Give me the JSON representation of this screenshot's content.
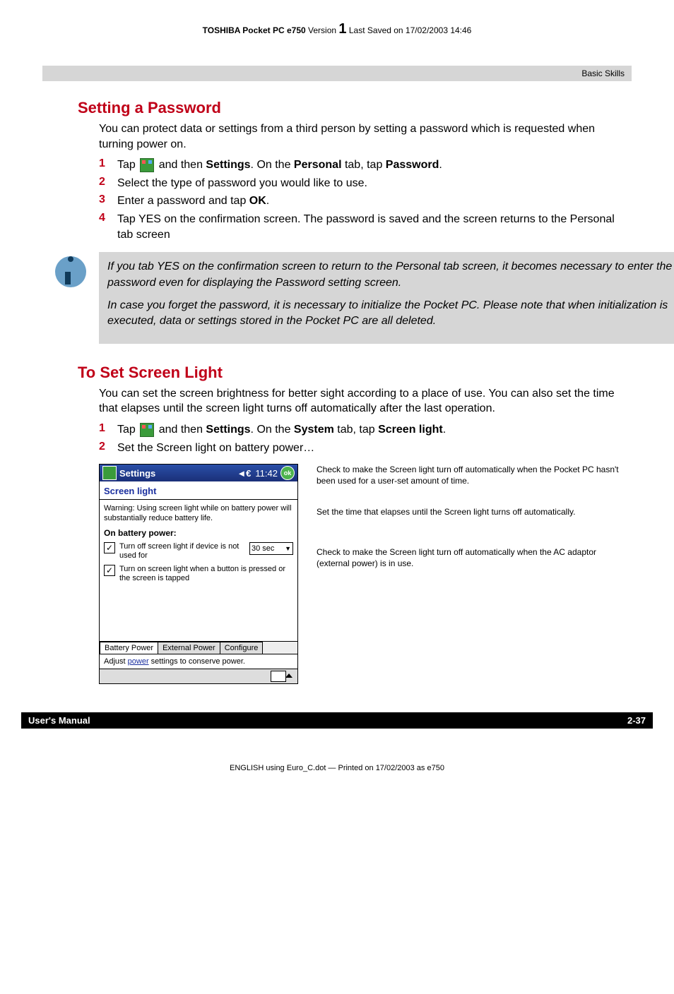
{
  "header": {
    "product_bold": "TOSHIBA Pocket PC e750",
    "version_label": "Version",
    "version_number": "1",
    "saved": "Last Saved on 17/02/2003 14:46"
  },
  "breadcrumb": "Basic Skills",
  "section1": {
    "heading": "Setting a Password",
    "intro": "You can protect data or settings from a third person by setting a password which is requested when turning power on.",
    "steps": {
      "s1a": "Tap ",
      "s1b": " and then ",
      "s1_settings": "Settings",
      "s1c": ". On the ",
      "s1_personal": "Personal",
      "s1d": " tab, tap ",
      "s1_password": "Password",
      "s1e": ".",
      "s2": "Select the type of password you would like to use.",
      "s3a": "Enter a password and tap ",
      "s3_ok": "OK",
      "s3b": ".",
      "s4": "Tap YES on the confirmation screen. The password is saved and the screen returns to the Personal tab screen"
    },
    "note": {
      "p1": "If you tab YES on the confirmation screen to return to the Personal tab screen, it becomes necessary to enter the password even for displaying the Password setting screen.",
      "p2": "In case you forget the password, it is necessary to initialize the Pocket PC. Please note that when initialization is executed, data or settings stored in the Pocket PC are all deleted."
    }
  },
  "section2": {
    "heading": "To Set Screen Light",
    "intro": "You can set the screen brightness for better sight according to a place of use. You can also set the time that elapses until the screen light turns off automatically after the last operation.",
    "steps": {
      "s1a": "Tap ",
      "s1b": " and then ",
      "s1_settings": "Settings",
      "s1c": ". On the ",
      "s1_system": "System",
      "s1d": " tab, tap ",
      "s1_screenlight": "Screen light",
      "s1e": ".",
      "s2": "Set the Screen light on battery power…"
    }
  },
  "screenshot": {
    "titlebar": {
      "title": "Settings",
      "sound": "◄€",
      "time": "11:42",
      "ok": "ok"
    },
    "heading": "Screen light",
    "warning": "Warning: Using screen light while on battery power will substantially reduce battery life.",
    "section": "On battery power:",
    "check1": "Turn off screen light if device is not used for",
    "dropdown": "30 sec",
    "check2": "Turn on screen light when a button is pressed or the screen is tapped",
    "tabs": {
      "t1": "Battery Power",
      "t2": "External Power",
      "t3": "Configure"
    },
    "link_row_a": "Adjust ",
    "link_row_link": "power",
    "link_row_b": " settings to conserve power."
  },
  "callouts": {
    "c1": "Check to make the Screen light turn off automatically when the Pocket PC hasn't been used for a user-set amount of time.",
    "c2": "Set the time that elapses until the Screen light turns off automatically.",
    "c3": "Check to make the Screen light turn off automatically when the AC adaptor (external power) is in use."
  },
  "footer": {
    "left": "User's Manual",
    "right": "2-37"
  },
  "bottom_print": "ENGLISH using Euro_C.dot — Printed on 17/02/2003 as e750"
}
